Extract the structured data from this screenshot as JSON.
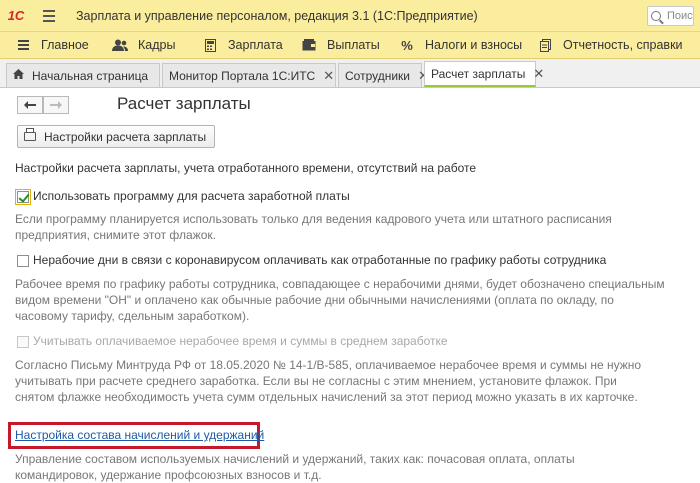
{
  "window": {
    "logo": "1С",
    "title": "Зарплата и управление персоналом, редакция 3.1  (1С:Предприятие)",
    "search_placeholder": "Поис"
  },
  "sections": [
    {
      "label": "Главное",
      "icon": "menu-icon"
    },
    {
      "label": "Кадры",
      "icon": "people-icon"
    },
    {
      "label": "Зарплата",
      "icon": "calculator-icon"
    },
    {
      "label": "Выплаты",
      "icon": "wallet-icon"
    },
    {
      "label": "Налоги и взносы",
      "icon": "percent-icon"
    },
    {
      "label": "Отчетность, справки",
      "icon": "report-icon"
    }
  ],
  "tabs": [
    {
      "label": "Начальная страница",
      "home": true,
      "closable": false,
      "active": false
    },
    {
      "label": "Монитор Портала 1С:ИТС",
      "closable": true,
      "active": false
    },
    {
      "label": "Сотрудники",
      "closable": true,
      "active": false
    },
    {
      "label": "Расчет зарплаты",
      "closable": true,
      "active": true
    }
  ],
  "page": {
    "title": "Расчет зарплаты",
    "back_label": "🡐",
    "forward_label": "🡒",
    "settings_button": "Настройки расчета зарплаты",
    "section_caption": "Настройки расчета зарплаты, учета отработанного времени, отсутствий на работе",
    "opt1": {
      "label": "Использовать программу для расчета заработной платы",
      "checked": true,
      "hint1": "Если программу планируется использовать только для ведения кадрового учета или штатного расписания",
      "hint2": "предприятия, снимите этот флажок."
    },
    "opt2": {
      "label": "Нерабочие дни в связи с коронавирусом оплачивать как отработанные по графику работы сотрудника",
      "checked": false,
      "hint1": "Рабочее время по графику работы сотрудника, совпадающее с нерабочими днями, будет обозначено специальным",
      "hint2": "видом времени \"ОН\" и оплачено как обычные рабочие дни обычными начислениями (оплата по окладу, по",
      "hint3": "часовому тарифу, сдельным заработком)."
    },
    "opt3": {
      "label": "Учитывать оплачиваемое нерабочее время и суммы в среднем заработке",
      "checked": false,
      "disabled": true,
      "hint1": "Согласно Письму Минтруда РФ от 18.05.2020 № 14-1/В-585, оплачиваемое нерабочее время и суммы не нужно",
      "hint2": "учитывать при расчете среднего заработка. Если вы не согласны с этим мнением, установите флажок. При",
      "hint3": "снятом флажке необходимость учета сумм отдельных начислений за этот период можно указать в их карточке."
    },
    "link": "Настройка состава начислений и удержаний",
    "link_hint1": "Управление составом используемых начислений и удержаний, таких как: почасовая оплата, оплаты",
    "link_hint2": "командировок, удержание профсоюзных взносов и т.д."
  }
}
